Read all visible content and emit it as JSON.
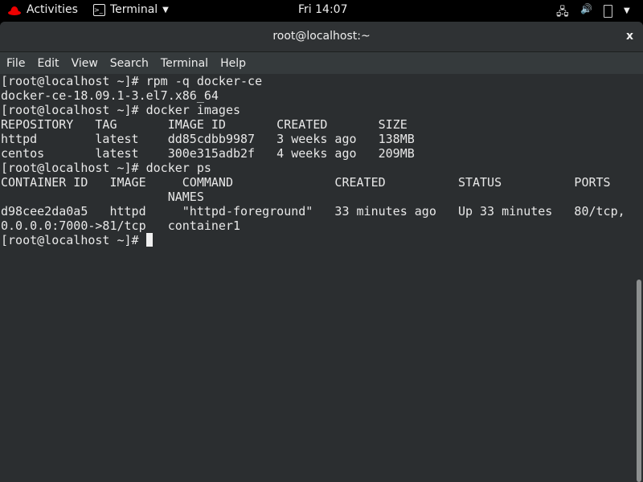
{
  "topbar": {
    "activities": "Activities",
    "app": "Terminal",
    "clock": "Fri 14:07"
  },
  "window": {
    "title": "root@localhost:~",
    "close": "x"
  },
  "menu": [
    "File",
    "Edit",
    "View",
    "Search",
    "Terminal",
    "Help"
  ],
  "terminal": {
    "lines": [
      "[root@localhost ~]# rpm -q docker-ce",
      "docker-ce-18.09.1-3.el7.x86_64",
      "[root@localhost ~]# docker images",
      "REPOSITORY   TAG       IMAGE ID       CREATED       SIZE",
      "httpd        latest    dd85cdbb9987   3 weeks ago   138MB",
      "centos       latest    300e315adb2f   4 weeks ago   209MB",
      "[root@localhost ~]# docker ps",
      "CONTAINER ID   IMAGE     COMMAND              CREATED          STATUS          PORTS",
      "                       NAMES",
      "d98cee2da0a5   httpd     \"httpd-foreground\"   33 minutes ago   Up 33 minutes   80/tcp,",
      "0.0.0.0:7000->81/tcp   container1"
    ],
    "prompt": "[root@localhost ~]# "
  }
}
